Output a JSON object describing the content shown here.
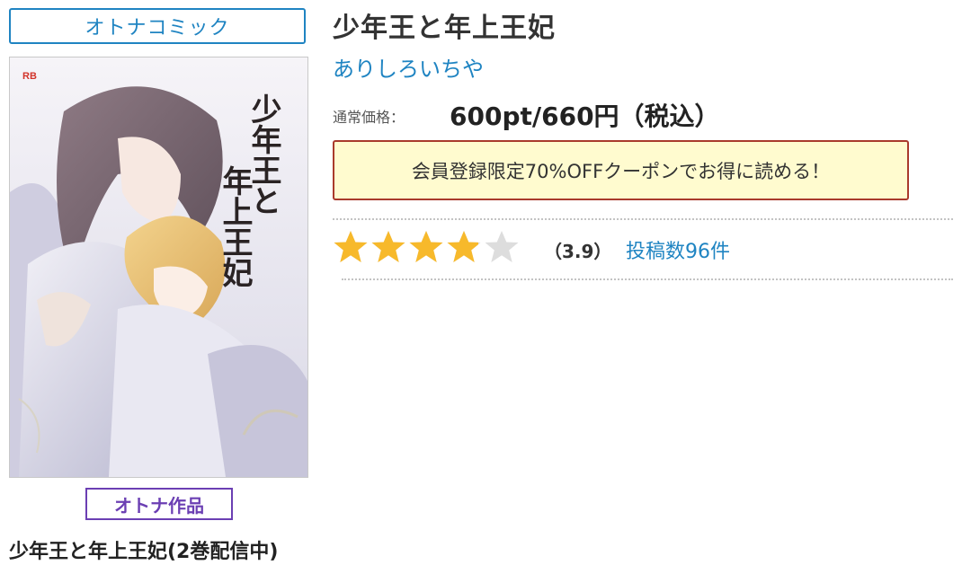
{
  "category": {
    "label": "オトナコミック"
  },
  "cover": {
    "alt": "少年王と年上王妃",
    "imprint": "RB",
    "title_vertical_1": "少年王と",
    "title_vertical_2": "年上王妃"
  },
  "badge": {
    "label": "オトナ作品"
  },
  "series": {
    "title": "少年王と年上王妃(2巻配信中)"
  },
  "book": {
    "title": "少年王と年上王妃",
    "author": "ありしろいちや",
    "price_label": "通常価格：",
    "price_value": "600pt/660円（税込）"
  },
  "coupon": {
    "text": "会員登録限定70%OFFクーポンでお得に読める！"
  },
  "rating": {
    "score": 3.9,
    "max": 5,
    "score_text": "（3.9）",
    "reviews_text": "投稿数96件",
    "star_color": "#f7b92b",
    "empty_color": "#dddddd"
  },
  "colors": {
    "accent": "#1f84c2",
    "adult": "#6b3fb3",
    "coupon_bg": "#fffbcf",
    "coupon_border": "#a93a2c"
  }
}
